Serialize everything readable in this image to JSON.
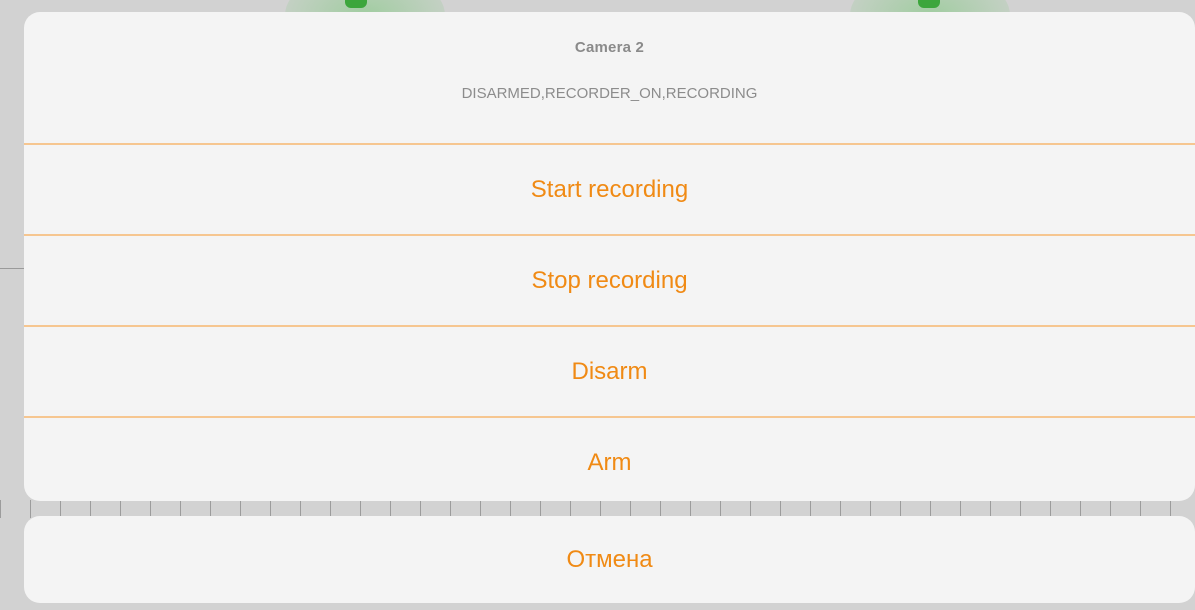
{
  "sheet": {
    "title": "Camera 2",
    "message": "DISARMED,RECORDER_ON,RECORDING",
    "actions": [
      {
        "label": "Start recording"
      },
      {
        "label": "Stop recording"
      },
      {
        "label": "Disarm"
      },
      {
        "label": "Arm"
      }
    ],
    "cancel_label": "Отмена"
  },
  "colors": {
    "accent": "#f08a14",
    "separator": "#f6c690",
    "sheet_background": "#f4f4f4",
    "secondary_text": "#8a8a8a"
  }
}
